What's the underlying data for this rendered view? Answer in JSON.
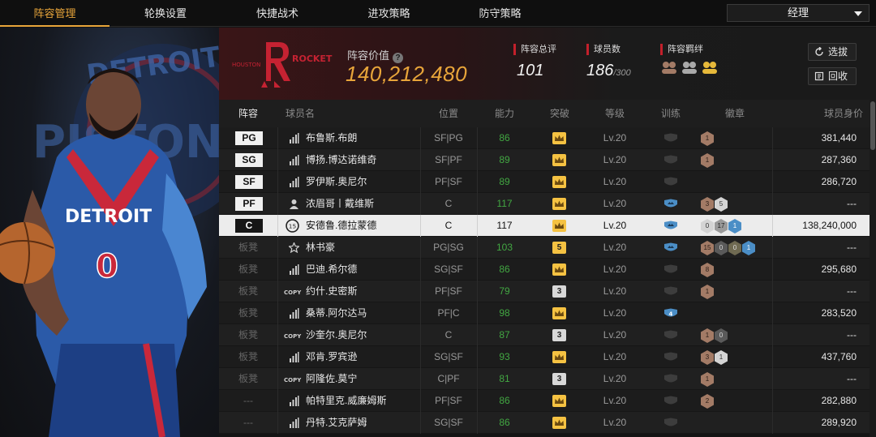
{
  "nav": {
    "tabs": [
      {
        "label": "阵容管理",
        "active": true
      },
      {
        "label": "轮换设置",
        "active": false
      },
      {
        "label": "快捷战术",
        "active": false
      },
      {
        "label": "进攻策略",
        "active": false
      },
      {
        "label": "防守策略",
        "active": false
      }
    ],
    "manager_select": "经理"
  },
  "art": {
    "backdrop_text_top": "DETROIT",
    "backdrop_text_mid": "PISTON",
    "jersey_text": "DETROIT",
    "jersey_number": "0"
  },
  "header": {
    "team_logo_left": "HOUSTON",
    "team_logo_right": "ROCKETS",
    "value_label": "阵容价值",
    "value_number": "140,212,480",
    "overall_label": "阵容总评",
    "overall_value": "101",
    "count_label": "球员数",
    "count_value": "186",
    "count_max": "/300",
    "bond_label": "阵容羁绊",
    "btn_select": "选拔",
    "btn_recycle": "回收"
  },
  "table": {
    "headers": [
      "阵容",
      "球员名",
      "位置",
      "能力",
      "突破",
      "等级",
      "训练",
      "徽章",
      "球员身价"
    ],
    "rows": [
      {
        "slot": "PG",
        "starter": true,
        "type": "bars",
        "name": "布鲁斯.布朗",
        "pos": "SF|PG",
        "ability": "86",
        "brk": "crown",
        "lvl": "Lv.20",
        "train": "none",
        "badges": [
          [
            "bronze",
            "1"
          ]
        ],
        "price": "381,440"
      },
      {
        "slot": "SG",
        "starter": true,
        "type": "bars",
        "name": "博扬.博达诺维奇",
        "pos": "SF|PF",
        "ability": "89",
        "brk": "crown",
        "lvl": "Lv.20",
        "train": "none",
        "badges": [
          [
            "bronze",
            "1"
          ]
        ],
        "price": "287,360"
      },
      {
        "slot": "SF",
        "starter": true,
        "type": "bars",
        "name": "罗伊斯.奥尼尔",
        "pos": "PF|SF",
        "ability": "89",
        "brk": "crown",
        "lvl": "Lv.20",
        "train": "none",
        "badges": [],
        "price": "286,720"
      },
      {
        "slot": "PF",
        "starter": true,
        "type": "person",
        "name": "浓眉哥丨戴维斯",
        "pos": "C",
        "ability": "117",
        "brk": "crown",
        "lvl": "Lv.20",
        "train": "blue",
        "badges": [
          [
            "bronze",
            "3"
          ],
          [
            "gray",
            "5"
          ]
        ],
        "price": "---"
      },
      {
        "slot": "C",
        "starter": true,
        "selected": true,
        "type": "num15",
        "name": "安德鲁.德拉蒙德",
        "pos": "C",
        "ability": "117",
        "brk": "crown",
        "lvl": "Lv.20",
        "train": "blue",
        "badges": [
          [
            "gray",
            "0"
          ],
          [
            "silver",
            "17"
          ],
          [
            "blue",
            "1"
          ]
        ],
        "price": "138,240,000"
      },
      {
        "slot": "板凳",
        "starter": false,
        "type": "star",
        "name": "林书豪",
        "pos": "PG|SG",
        "ability": "103",
        "brk": "5",
        "lvl": "Lv.20",
        "train": "blue",
        "badges": [
          [
            "bronze",
            "15"
          ],
          [
            "silverdk",
            "0"
          ],
          [
            "gold",
            "0"
          ],
          [
            "blue",
            "1"
          ]
        ],
        "price": "---"
      },
      {
        "slot": "板凳",
        "starter": false,
        "type": "bars",
        "name": "巴迪.希尔德",
        "pos": "SG|SF",
        "ability": "86",
        "brk": "crown",
        "lvl": "Lv.20",
        "train": "none",
        "badges": [
          [
            "bronze",
            "8"
          ]
        ],
        "price": "295,680"
      },
      {
        "slot": "板凳",
        "starter": false,
        "type": "copy",
        "name": "约什.史密斯",
        "pos": "PF|SF",
        "ability": "79",
        "brk": "3",
        "lvl": "Lv.20",
        "train": "none",
        "badges": [
          [
            "bronze",
            "1"
          ]
        ],
        "price": "---"
      },
      {
        "slot": "板凳",
        "starter": false,
        "type": "bars",
        "name": "桑蒂.阿尔达马",
        "pos": "PF|C",
        "ability": "98",
        "brk": "crown",
        "lvl": "Lv.20",
        "train": "blue4",
        "badges": [],
        "price": "283,520"
      },
      {
        "slot": "板凳",
        "starter": false,
        "type": "copy",
        "name": "沙奎尔.奥尼尔",
        "pos": "C",
        "ability": "87",
        "brk": "3",
        "lvl": "Lv.20",
        "train": "none",
        "badges": [
          [
            "bronze",
            "1"
          ],
          [
            "silverdk",
            "0"
          ]
        ],
        "price": "---"
      },
      {
        "slot": "板凳",
        "starter": false,
        "type": "bars",
        "name": "邓肯.罗宾逊",
        "pos": "SG|SF",
        "ability": "93",
        "brk": "crown",
        "lvl": "Lv.20",
        "train": "none",
        "badges": [
          [
            "bronze",
            "3"
          ],
          [
            "gray",
            "1"
          ]
        ],
        "price": "437,760"
      },
      {
        "slot": "板凳",
        "starter": false,
        "type": "copy",
        "name": "阿隆佐.莫宁",
        "pos": "C|PF",
        "ability": "81",
        "brk": "3",
        "lvl": "Lv.20",
        "train": "none",
        "badges": [
          [
            "bronze",
            "1"
          ]
        ],
        "price": "---"
      },
      {
        "slot": "---",
        "starter": false,
        "type": "bars",
        "name": "帕特里克.威廉姆斯",
        "pos": "PF|SF",
        "ability": "86",
        "brk": "crown",
        "lvl": "Lv.20",
        "train": "none",
        "badges": [
          [
            "bronze",
            "2"
          ]
        ],
        "price": "282,880"
      },
      {
        "slot": "---",
        "starter": false,
        "type": "bars",
        "name": "丹特.艾克萨姆",
        "pos": "SG|SF",
        "ability": "86",
        "brk": "crown",
        "lvl": "Lv.20",
        "train": "none",
        "badges": [],
        "price": "289,920"
      }
    ]
  },
  "colors": {
    "accent": "#e8a53a",
    "ability_green": "#42a742",
    "red_marker": "#c3202b"
  }
}
